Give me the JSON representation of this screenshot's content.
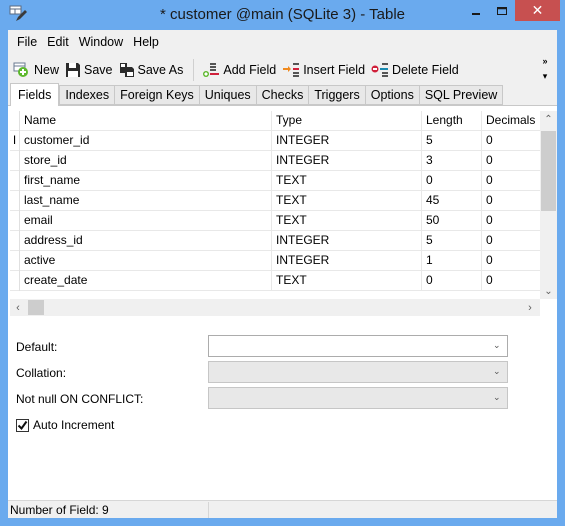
{
  "window": {
    "title": "* customer @main (SQLite 3) - Table",
    "minimize_label": "–",
    "close_label": "✕"
  },
  "menu": [
    "File",
    "Edit",
    "Window",
    "Help"
  ],
  "toolbar": {
    "new_label": "New",
    "save_label": "Save",
    "save_as_label": "Save As",
    "add_field_label": "Add Field",
    "insert_field_label": "Insert Field",
    "delete_field_label": "Delete Field",
    "overflow_label": "»",
    "overflow_dropdown": "▾"
  },
  "tabs": [
    "Fields",
    "Indexes",
    "Foreign Keys",
    "Uniques",
    "Checks",
    "Triggers",
    "Options",
    "SQL Preview"
  ],
  "active_tab": "Fields",
  "grid": {
    "columns": [
      "Name",
      "Type",
      "Length",
      "Decimals"
    ],
    "current_row_indicator": "I",
    "rows": [
      {
        "name": "customer_id",
        "type": "INTEGER",
        "length": "5",
        "decimals": "0"
      },
      {
        "name": "store_id",
        "type": "INTEGER",
        "length": "3",
        "decimals": "0"
      },
      {
        "name": "first_name",
        "type": "TEXT",
        "length": "0",
        "decimals": "0"
      },
      {
        "name": "last_name",
        "type": "TEXT",
        "length": "45",
        "decimals": "0"
      },
      {
        "name": "email",
        "type": "TEXT",
        "length": "50",
        "decimals": "0"
      },
      {
        "name": "address_id",
        "type": "INTEGER",
        "length": "5",
        "decimals": "0"
      },
      {
        "name": "active",
        "type": "INTEGER",
        "length": "1",
        "decimals": "0"
      },
      {
        "name": "create_date",
        "type": "TEXT",
        "length": "0",
        "decimals": "0"
      }
    ]
  },
  "properties": {
    "default_label": "Default:",
    "default_value": "",
    "collation_label": "Collation:",
    "collation_value": "",
    "not_null_label": "Not null ON CONFLICT:",
    "not_null_value": "",
    "auto_increment_label": "Auto Increment",
    "auto_increment_checked": true
  },
  "status": {
    "field_count_text": "Number of Field: 9"
  }
}
